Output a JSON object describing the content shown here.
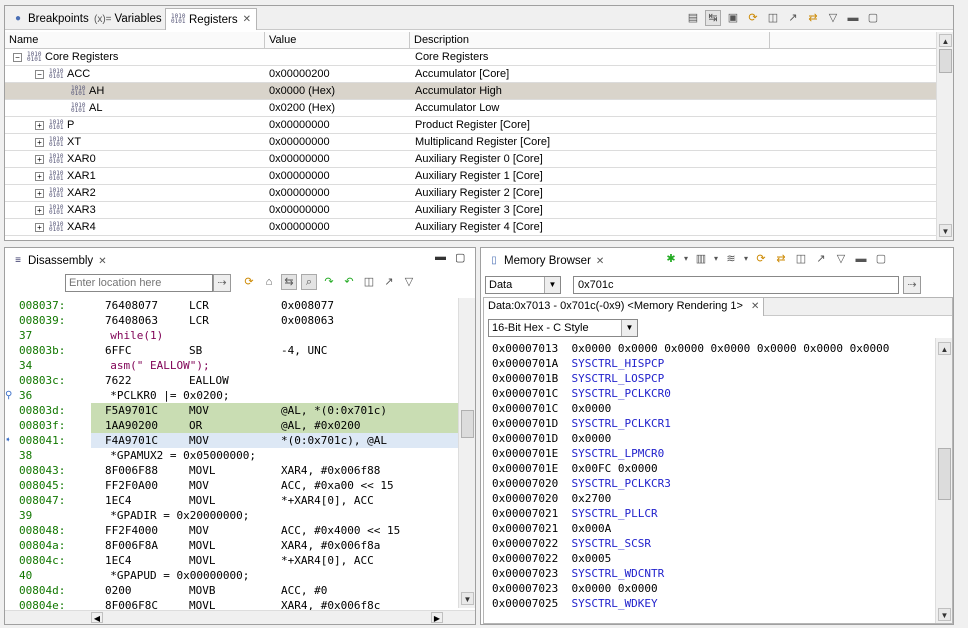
{
  "top_panel": {
    "tabs": [
      {
        "label": "Breakpoints",
        "icon": "breakpoints-icon"
      },
      {
        "label": "Variables",
        "prefix": "(x)=",
        "icon": "variables-icon"
      },
      {
        "label": "Registers",
        "icon": "registers-icon",
        "active": true
      }
    ],
    "columns": [
      "Name",
      "Value",
      "Description"
    ],
    "rows": [
      {
        "name": "Core Registers",
        "value": "",
        "desc": "Core Registers",
        "level": 0,
        "expander": "−"
      },
      {
        "name": "ACC",
        "value": "0x00000200",
        "desc": "Accumulator [Core]",
        "level": 1,
        "expander": "−"
      },
      {
        "name": "AH",
        "value": "0x0000 (Hex)",
        "desc": "Accumulator High",
        "level": 2,
        "expander": "",
        "selected": true
      },
      {
        "name": "AL",
        "value": "0x0200 (Hex)",
        "desc": "Accumulator Low",
        "level": 2,
        "expander": ""
      },
      {
        "name": "P",
        "value": "0x00000000",
        "desc": "Product Register [Core]",
        "level": 1,
        "expander": "+"
      },
      {
        "name": "XT",
        "value": "0x00000000",
        "desc": "Multiplicand Register [Core]",
        "level": 1,
        "expander": "+"
      },
      {
        "name": "XAR0",
        "value": "0x00000000",
        "desc": "Auxiliary Register 0 [Core]",
        "level": 1,
        "expander": "+"
      },
      {
        "name": "XAR1",
        "value": "0x00000000",
        "desc": "Auxiliary Register 1 [Core]",
        "level": 1,
        "expander": "+"
      },
      {
        "name": "XAR2",
        "value": "0x00000000",
        "desc": "Auxiliary Register 2 [Core]",
        "level": 1,
        "expander": "+"
      },
      {
        "name": "XAR3",
        "value": "0x00000000",
        "desc": "Auxiliary Register 3 [Core]",
        "level": 1,
        "expander": "+"
      },
      {
        "name": "XAR4",
        "value": "0x00000000",
        "desc": "Auxiliary Register 4 [Core]",
        "level": 1,
        "expander": "+"
      }
    ]
  },
  "disassembly": {
    "tab_label": "Disassembly",
    "location_placeholder": "Enter location here",
    "lines": [
      {
        "kind": "asm",
        "addr": "008037:",
        "op": "76408077",
        "mn": "LCR",
        "args": "0x008077"
      },
      {
        "kind": "asm",
        "addr": "008039:",
        "op": "76408063",
        "mn": "LCR",
        "args": "0x008063"
      },
      {
        "kind": "src",
        "num": "37",
        "code": "  while(1)"
      },
      {
        "kind": "asm",
        "addr": "00803b:",
        "op": "6FFC",
        "mn": "SB",
        "args": "-4, UNC"
      },
      {
        "kind": "src",
        "num": "34",
        "code": "  asm(\" EALLOW\");"
      },
      {
        "kind": "asm",
        "addr": "00803c:",
        "op": "7622",
        "mn": "EALLOW",
        "args": ""
      },
      {
        "kind": "src",
        "num": "36",
        "code": "  *PCLKR0 |= 0x0200;",
        "marker": "bp"
      },
      {
        "kind": "asm",
        "addr": "00803d:",
        "op": "F5A9701C",
        "mn": "MOV",
        "args": "@AL, *(0:0x701c)",
        "hl": "g"
      },
      {
        "kind": "asm",
        "addr": "00803f:",
        "op": "1AA90200",
        "mn": "OR",
        "args": "@AL, #0x0200",
        "hl": "g"
      },
      {
        "kind": "asm",
        "addr": "008041:",
        "op": "F4A9701C",
        "mn": "MOV",
        "args": "*(0:0x701c), @AL",
        "hl": "cur",
        "marker": "pc"
      },
      {
        "kind": "src",
        "num": "38",
        "code": "  *GPAMUX2 = 0x05000000;"
      },
      {
        "kind": "asm",
        "addr": "008043:",
        "op": "8F006F88",
        "mn": "MOVL",
        "args": "XAR4, #0x006f88"
      },
      {
        "kind": "asm",
        "addr": "008045:",
        "op": "FF2F0A00",
        "mn": "MOV",
        "args": "ACC, #0xa00 << 15"
      },
      {
        "kind": "asm",
        "addr": "008047:",
        "op": "1EC4",
        "mn": "MOVL",
        "args": "*+XAR4[0], ACC"
      },
      {
        "kind": "src",
        "num": "39",
        "code": "  *GPADIR = 0x20000000;"
      },
      {
        "kind": "asm",
        "addr": "008048:",
        "op": "FF2F4000",
        "mn": "MOV",
        "args": "ACC, #0x4000 << 15"
      },
      {
        "kind": "asm",
        "addr": "00804a:",
        "op": "8F006F8A",
        "mn": "MOVL",
        "args": "XAR4, #0x006f8a"
      },
      {
        "kind": "asm",
        "addr": "00804c:",
        "op": "1EC4",
        "mn": "MOVL",
        "args": "*+XAR4[0], ACC"
      },
      {
        "kind": "src",
        "num": "40",
        "code": "  *GPAPUD = 0x00000000;"
      },
      {
        "kind": "asm",
        "addr": "00804d:",
        "op": "0200",
        "mn": "MOVB",
        "args": "ACC, #0"
      },
      {
        "kind": "asm",
        "addr": "00804e:",
        "op": "8F006F8C",
        "mn": "MOVL",
        "args": "XAR4, #0x006f8c"
      }
    ]
  },
  "memory": {
    "tab_label": "Memory Browser",
    "page": "Data",
    "address": "0x701c",
    "rendering_tab": "Data:0x7013 - 0x701c(-0x9) <Memory Rendering 1>",
    "format": "16-Bit Hex - C Style",
    "lines": [
      {
        "addr": "0x00007013",
        "text": "0x0000 0x0000 0x0000 0x0000 0x0000 0x0000 0x0000",
        "kind": "val"
      },
      {
        "addr": "0x0000701A",
        "text": "SYSCTRL_HISPCP",
        "kind": "sym"
      },
      {
        "addr": "0x0000701B",
        "text": "SYSCTRL_LOSPCP",
        "kind": "sym"
      },
      {
        "addr": "0x0000701C",
        "text": "SYSCTRL_PCLKCR0",
        "kind": "sym"
      },
      {
        "addr": "0x0000701C",
        "text": "0x0000",
        "kind": "val"
      },
      {
        "addr": "0x0000701D",
        "text": "SYSCTRL_PCLKCR1",
        "kind": "sym"
      },
      {
        "addr": "0x0000701D",
        "text": "0x0000",
        "kind": "val"
      },
      {
        "addr": "0x0000701E",
        "text": "SYSCTRL_LPMCR0",
        "kind": "sym"
      },
      {
        "addr": "0x0000701E",
        "text": "0x00FC 0x0000",
        "kind": "val"
      },
      {
        "addr": "0x00007020",
        "text": "SYSCTRL_PCLKCR3",
        "kind": "sym"
      },
      {
        "addr": "0x00007020",
        "text": "0x2700",
        "kind": "val"
      },
      {
        "addr": "0x00007021",
        "text": "SYSCTRL_PLLCR",
        "kind": "sym"
      },
      {
        "addr": "0x00007021",
        "text": "0x000A",
        "kind": "val"
      },
      {
        "addr": "0x00007022",
        "text": "SYSCTRL_SCSR",
        "kind": "sym"
      },
      {
        "addr": "0x00007022",
        "text": "0x0005",
        "kind": "val"
      },
      {
        "addr": "0x00007023",
        "text": "SYSCTRL_WDCNTR",
        "kind": "sym"
      },
      {
        "addr": "0x00007023",
        "text": "0x0000 0x0000",
        "kind": "val"
      },
      {
        "addr": "0x00007025",
        "text": "SYSCTRL_WDKEY",
        "kind": "sym"
      }
    ]
  },
  "colors": {
    "selected_row": "#d9d4cb",
    "green_highlight": "#c9ddb3",
    "address_green": "#117700",
    "symbol_blue": "#2222cc"
  }
}
